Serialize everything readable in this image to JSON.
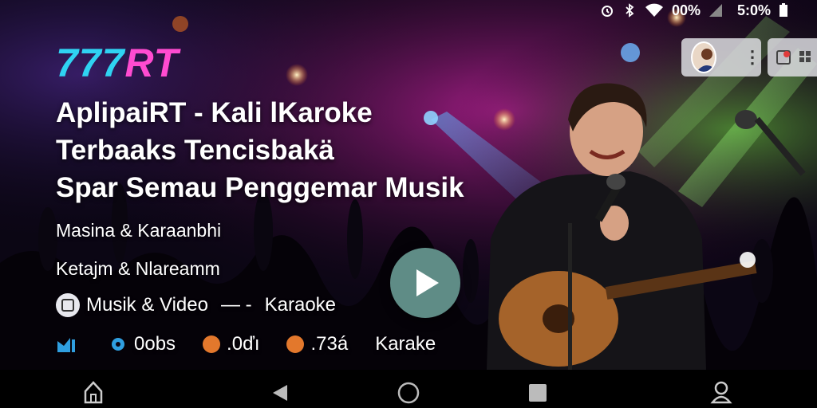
{
  "status_bar": {
    "battery_percent": "00%",
    "time": "5:0%",
    "icons": [
      "alarm-icon",
      "bluetooth-icon",
      "wifi-icon",
      "signal-icon",
      "battery-icon"
    ]
  },
  "brand": {
    "logo_part1": "777",
    "logo_part2": "RT",
    "accent_cyan": "#2fd3f2",
    "accent_pink": "#ff4bd0"
  },
  "headline": {
    "line1": "AplipaiRT - Kali lKaroke",
    "line2": "Terbaaks Tencisbakä",
    "line3": "Spar Semau Penggemar Musik"
  },
  "subtitles": {
    "line1": "Masina & Karaanbhi",
    "line2": "Ketajm & Nlareamm"
  },
  "tagline": {
    "left": "Musik & Video",
    "dash": "— -",
    "right": "Karaoke"
  },
  "stats": {
    "item1": "0obs",
    "item2": ".0ďı",
    "item3": ".73á",
    "item4": "Karake",
    "dot_color": "#e3782c"
  },
  "actions": {
    "play_icon": "play-icon",
    "play_color": "#5f8c86"
  },
  "nav": {
    "items": [
      "home-icon",
      "back-icon",
      "home-circle-icon",
      "recents-icon",
      "profile-icon"
    ]
  }
}
